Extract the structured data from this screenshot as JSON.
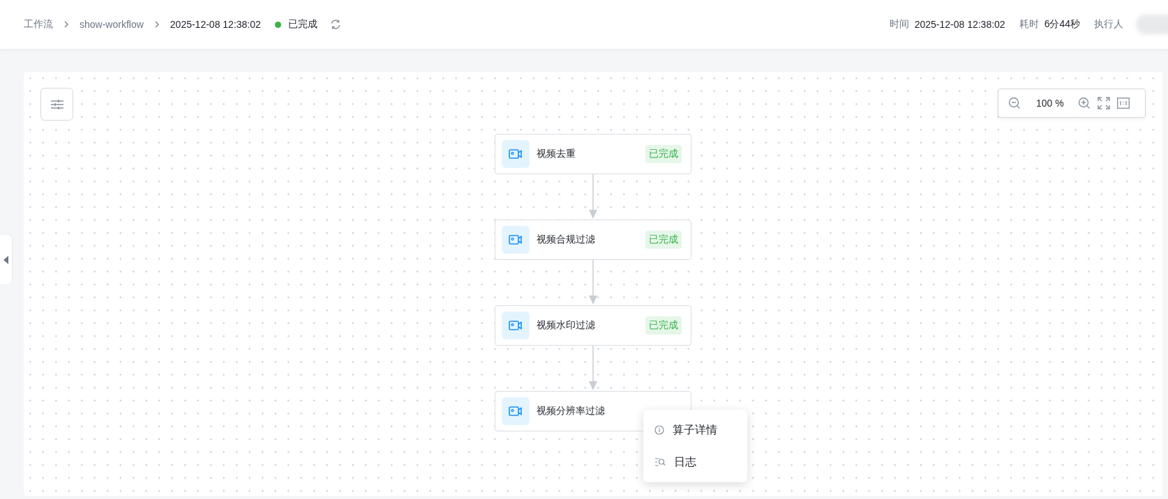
{
  "header": {
    "breadcrumbs": [
      "工作流",
      "show-workflow",
      "2025-12-08 12:38:02"
    ],
    "status": {
      "label": "已完成",
      "color": "#3bb346"
    },
    "meta": [
      {
        "label": "时间",
        "value": "2025-12-08 12:38:02"
      },
      {
        "label": "耗时",
        "value": "6分44秒"
      }
    ],
    "executor_label": "执行人"
  },
  "zoom": {
    "value": "100 %"
  },
  "nodes": [
    {
      "name": "视频去重",
      "status": "已完成",
      "color": "#35b34a"
    },
    {
      "name": "视频合规过滤",
      "status": "已完成",
      "color": "#35b34a"
    },
    {
      "name": "视频水印过滤",
      "status": "已完成",
      "color": "#35b34a"
    },
    {
      "name": "视频分辨率过滤"
    }
  ],
  "context_menu": [
    {
      "label": "算子详情",
      "kind": "info"
    },
    {
      "label": "日志",
      "kind": "log"
    }
  ]
}
